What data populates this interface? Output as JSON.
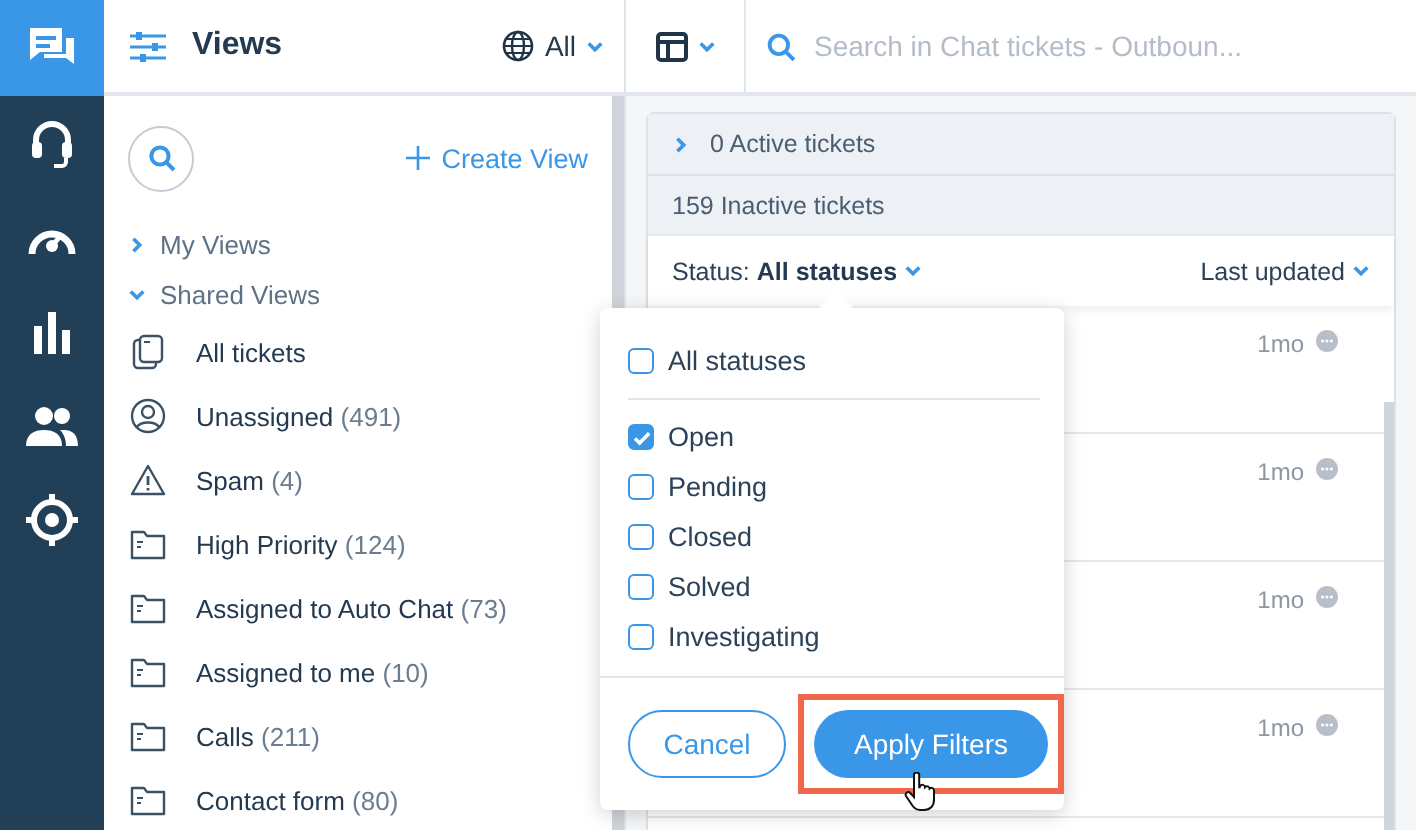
{
  "rail": [
    {
      "kind": "chat",
      "selected": true
    },
    {
      "kind": "headset",
      "selected": false
    },
    {
      "kind": "gauge",
      "selected": false
    },
    {
      "kind": "bars",
      "selected": false
    },
    {
      "kind": "people",
      "selected": false
    },
    {
      "kind": "target",
      "selected": false
    }
  ],
  "views_panel": {
    "title": "Views",
    "filter": "All",
    "create_label": "Create View",
    "groups": [
      {
        "label": "My Views",
        "expanded": false
      },
      {
        "label": "Shared Views",
        "expanded": true,
        "children": [
          {
            "label": "All tickets",
            "kind": "pages"
          },
          {
            "label": "Unassigned",
            "count": "(491)",
            "kind": "user"
          },
          {
            "label": "Spam",
            "count": "(4)",
            "kind": "warning"
          },
          {
            "label": "High Priority",
            "count": "(124)",
            "kind": "folder"
          },
          {
            "label": "Assigned to Auto Chat",
            "count": "(73)",
            "kind": "folder"
          },
          {
            "label": "Assigned to me",
            "count": "(10)",
            "kind": "folder"
          },
          {
            "label": "Calls",
            "count": "(211)",
            "kind": "folder"
          },
          {
            "label": "Contact form",
            "count": "(80)",
            "kind": "folder"
          }
        ]
      }
    ]
  },
  "search": {
    "placeholder": "Search in Chat tickets - Outboun..."
  },
  "tickets": {
    "active": {
      "label": "0 Active tickets",
      "expanded": false
    },
    "inactive": "159 Inactive tickets",
    "status_label": "Status:",
    "status_value": "All statuses",
    "sort": "Last updated",
    "rows": [
      {
        "time": "1mo"
      },
      {
        "time": "1mo"
      },
      {
        "time": "1mo"
      },
      {
        "time": "1mo"
      }
    ]
  },
  "status_popup": {
    "all": {
      "label": "All statuses",
      "checked": false
    },
    "options": [
      {
        "label": "Open",
        "checked": true
      },
      {
        "label": "Pending",
        "checked": false
      },
      {
        "label": "Closed",
        "checked": false
      },
      {
        "label": "Solved",
        "checked": false
      },
      {
        "label": "Investigating",
        "checked": false
      }
    ],
    "cancel": "Cancel",
    "apply": {
      "label": "Apply Filters",
      "highlighted": true
    }
  }
}
